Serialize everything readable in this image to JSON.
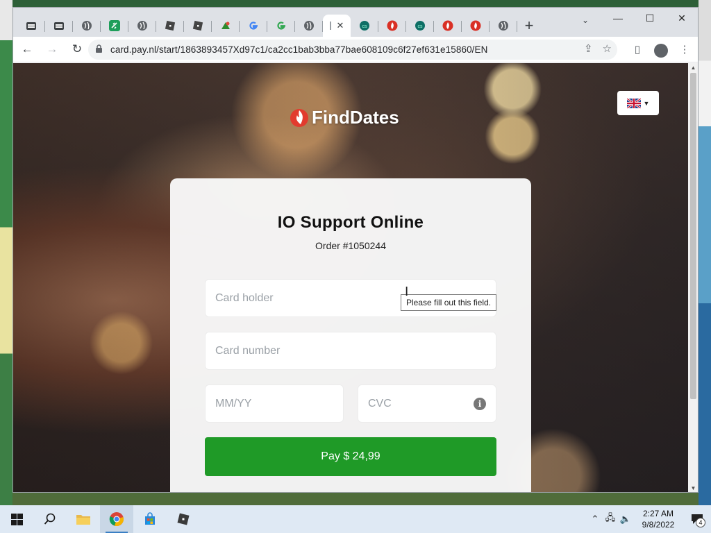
{
  "browser": {
    "tabs": [
      {
        "icon": "app-icon",
        "color": "#3c4043"
      },
      {
        "icon": "app-icon",
        "color": "#3c4043"
      },
      {
        "icon": "globe-icon",
        "color": "#5f6368"
      },
      {
        "icon": "link-icon",
        "color": "#1e9e5a"
      },
      {
        "icon": "globe-icon",
        "color": "#5f6368"
      },
      {
        "icon": "roblox-icon",
        "color": "#444444"
      },
      {
        "icon": "roblox-icon",
        "color": "#444444"
      },
      {
        "icon": "green-app-icon",
        "color": "#2e8b2e"
      },
      {
        "icon": "google-icon",
        "color": "#4285f4"
      },
      {
        "icon": "google-icon",
        "color": "#4285f4"
      },
      {
        "icon": "globe-icon",
        "color": "#5f6368"
      },
      {
        "icon": "active-tab",
        "color": "#9aa0a6"
      },
      {
        "icon": "teal-app-icon",
        "color": "#0e6f66"
      },
      {
        "icon": "fire-icon",
        "color": "#d93025"
      },
      {
        "icon": "teal-app-icon",
        "color": "#0e6f66"
      },
      {
        "icon": "fire-icon",
        "color": "#d93025"
      },
      {
        "icon": "fire-icon",
        "color": "#d93025"
      },
      {
        "icon": "globe-icon",
        "color": "#5f6368"
      }
    ],
    "url": "card.pay.nl/start/1863893457Xd97c1/ca2cc1bab3bba77bae608109c6f27ef631e15860/EN"
  },
  "page": {
    "brand": "FindDates",
    "merchant_title": "IO Support Online",
    "order": "Order #1050244",
    "fields": {
      "card_holder_placeholder": "Card holder",
      "card_number_placeholder": "Card number",
      "expiry_placeholder": "MM/YY",
      "cvc_placeholder": "CVC"
    },
    "pay_label": "Pay $ 24,99",
    "tooltip": "Please fill out this field.",
    "pay_color": "#1f9a27",
    "language": "English"
  },
  "taskbar": {
    "time": "2:27 AM",
    "date": "9/8/2022",
    "notifications": "4",
    "apps": [
      "windows-start-icon",
      "search-icon",
      "file-explorer-icon",
      "chrome-icon",
      "store-icon",
      "roblox-icon"
    ]
  }
}
